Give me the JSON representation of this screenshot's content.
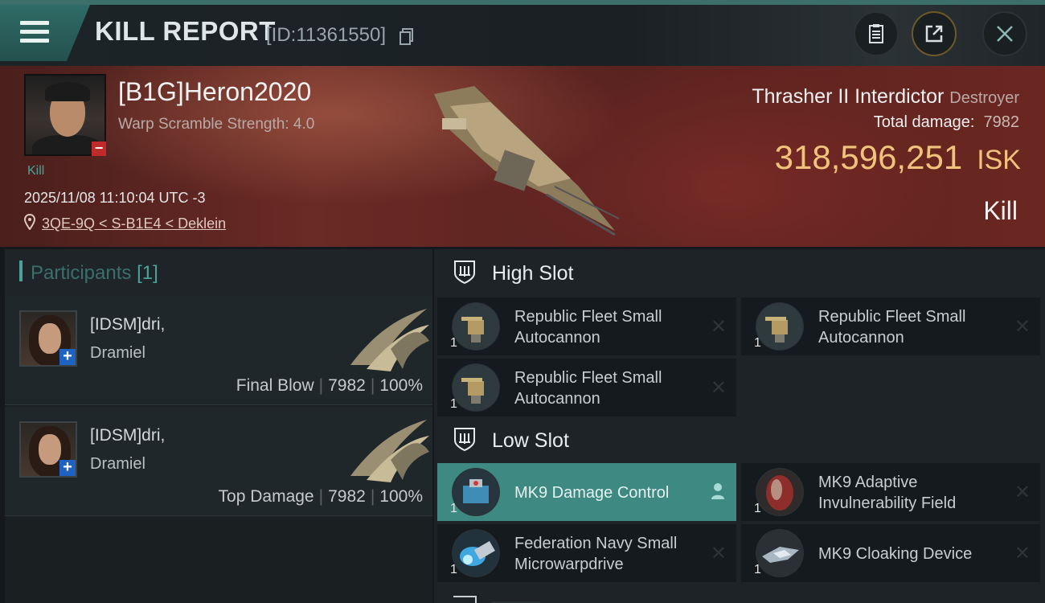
{
  "header": {
    "title": "KILL REPORT",
    "report_id": "[ID:11361550]",
    "icons": [
      "menu-icon",
      "copy-icon",
      "clipboard-icon",
      "share-icon",
      "close-icon"
    ]
  },
  "victim": {
    "name": "[B1G]Heron2020",
    "warp_scramble": "Warp Scramble Strength: 4.0",
    "kill_label": "Kill",
    "time": "2025/11/08 11:10:04 UTC -3",
    "location": "3QE-9Q < S-B1E4 < Deklein",
    "badge": "−"
  },
  "ship": {
    "name": "Thrasher II Interdictor",
    "class": "Destroyer",
    "total_damage_label": "Total damage:",
    "total_damage": "7982",
    "isk_value": "318,596,251",
    "isk_unit": "ISK",
    "result": "Kill"
  },
  "participants": {
    "title": "Participants",
    "count": "[1]",
    "items": [
      {
        "name1": "[IDSM]dri,",
        "name2": "Dramiel",
        "role": "Final Blow",
        "damage": "7982",
        "percent": "100%",
        "badge": "+"
      },
      {
        "name1": "[IDSM]dri,",
        "name2": "Dramiel",
        "role": "Top Damage",
        "damage": "7982",
        "percent": "100%",
        "badge": "+"
      }
    ]
  },
  "fitting": {
    "high_slot_label": "High Slot",
    "low_slot_label": "Low Slot",
    "high": [
      {
        "name": "Republic Fleet Small Autocannon",
        "qty": "1",
        "status": "destroyed"
      },
      {
        "name": "Republic Fleet Small Autocannon",
        "qty": "1",
        "status": "destroyed"
      },
      {
        "name": "Republic Fleet Small Autocannon",
        "qty": "1",
        "status": "destroyed"
      }
    ],
    "low": [
      {
        "name": "MK9 Damage Control",
        "qty": "1",
        "status": "dropped"
      },
      {
        "name": "MK9 Adaptive Invulnerability Field",
        "qty": "1",
        "status": "destroyed"
      },
      {
        "name": "Federation Navy Small Microwarpdrive",
        "qty": "1",
        "status": "destroyed"
      },
      {
        "name": "MK9 Cloaking Device",
        "qty": "1",
        "status": "destroyed"
      }
    ],
    "destroyed_mark": "✕"
  },
  "colors": {
    "accent": "#4aa29a",
    "isk": "#f0c27b",
    "banner": "#6a2a25",
    "active_module": "#3e8a83"
  }
}
